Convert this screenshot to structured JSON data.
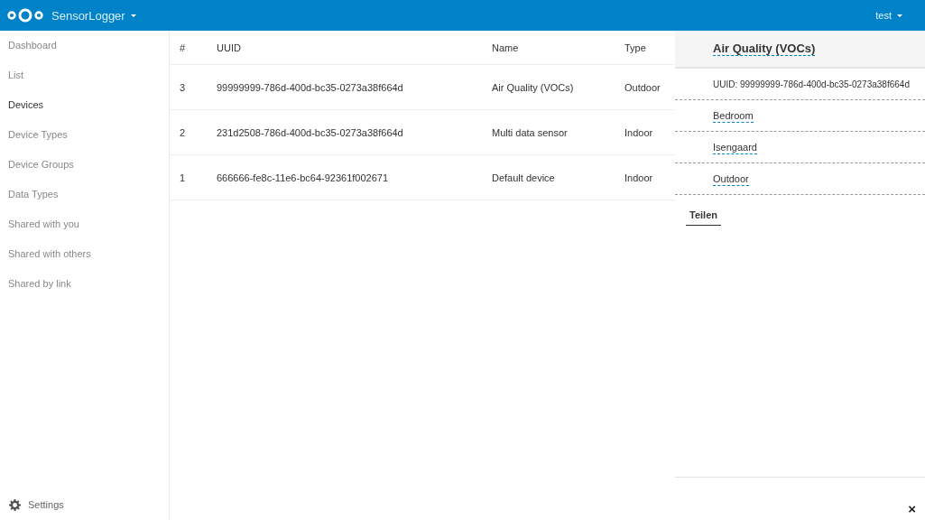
{
  "header": {
    "app_name": "SensorLogger",
    "user": "test"
  },
  "sidebar": {
    "items": [
      {
        "label": "Dashboard",
        "selected": false
      },
      {
        "label": "List",
        "selected": false
      },
      {
        "label": "Devices",
        "selected": true
      },
      {
        "label": "Device Types",
        "selected": false
      },
      {
        "label": "Device Groups",
        "selected": false
      },
      {
        "label": "Data Types",
        "selected": false
      },
      {
        "label": "Shared with you",
        "selected": false
      },
      {
        "label": "Shared with others",
        "selected": false
      },
      {
        "label": "Shared by link",
        "selected": false
      }
    ],
    "settings": "Settings"
  },
  "table": {
    "columns": [
      "#",
      "UUID",
      "Name",
      "Type"
    ],
    "rows": [
      [
        "3",
        "99999999-786d-400d-bc35-0273a38f664d",
        "Air Quality (VOCs)",
        "Outdoor"
      ],
      [
        "2",
        "231d2508-786d-400d-bc35-0273a38f664d",
        "Multi data sensor",
        "Indoor"
      ],
      [
        "1",
        "666666-fe8c-11e6-bc64-92361f002671",
        "Default device",
        "Indoor"
      ]
    ]
  },
  "details": {
    "title": "Air Quality (VOCs)",
    "uuid": "UUID: 99999999-786d-400d-bc35-0273a38f664d",
    "fields": [
      "Bedroom",
      "Isengaard",
      "Outdoor"
    ],
    "tabs": [
      {
        "label": "Teilen",
        "selected": true
      }
    ],
    "close": "×"
  }
}
